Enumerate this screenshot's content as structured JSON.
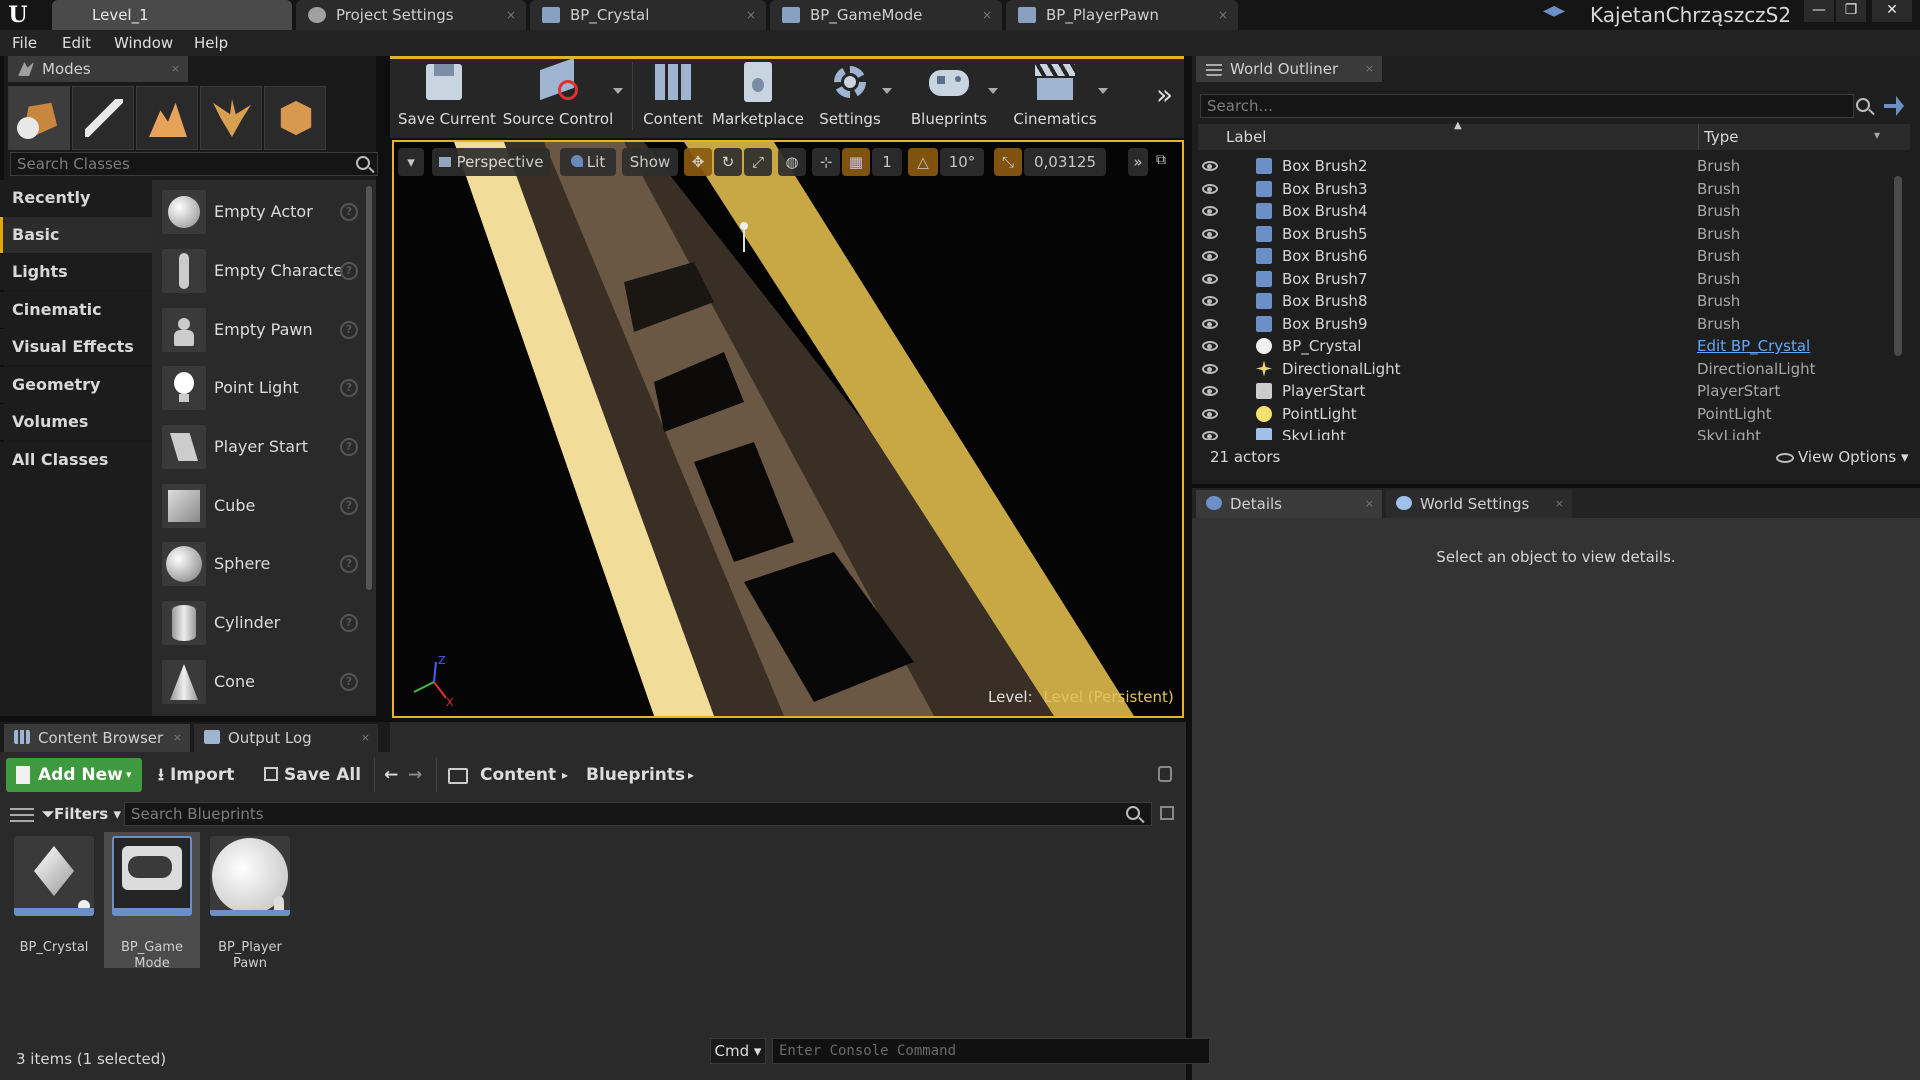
{
  "title_bar": {
    "logo": "U",
    "tabs": [
      {
        "label": "Level_1",
        "close": "×"
      },
      {
        "label": "Project Settings",
        "close": "×"
      },
      {
        "label": "BP_Crystal",
        "close": "×"
      },
      {
        "label": "BP_GameMode",
        "close": "×"
      },
      {
        "label": "BP_PlayerPawn",
        "close": "×"
      }
    ],
    "user": "KajetanChrząszczS2",
    "window_controls": {
      "minimize": "—",
      "restore": "❐",
      "close": "✕"
    }
  },
  "menu": {
    "items": [
      "File",
      "Edit",
      "Window",
      "Help"
    ]
  },
  "modes_panel": {
    "tab_label": "Modes",
    "tab_close": "×",
    "search_placeholder": "Search Classes",
    "categories": [
      "Recently Placed",
      "Basic",
      "Lights",
      "Cinematic",
      "Visual Effects",
      "Geometry",
      "Volumes",
      "All Classes"
    ],
    "active_category": "Basic",
    "items": [
      "Empty Actor",
      "Empty Characte",
      "Empty Pawn",
      "Point Light",
      "Player Start",
      "Cube",
      "Sphere",
      "Cylinder",
      "Cone"
    ],
    "help_glyph": "?"
  },
  "toolbar": {
    "buttons": [
      {
        "label": "Save Current",
        "icon": "save-icon"
      },
      {
        "label": "Source Control",
        "icon": "source-control-icon"
      },
      {
        "label": "Content",
        "icon": "content-icon"
      },
      {
        "label": "Marketplace",
        "icon": "marketplace-icon"
      },
      {
        "label": "Settings",
        "icon": "settings-icon"
      },
      {
        "label": "Blueprints",
        "icon": "blueprints-icon"
      },
      {
        "label": "Cinematics",
        "icon": "cinematics-icon"
      }
    ],
    "overflow": "»"
  },
  "viewport": {
    "menu_glyph": "▾",
    "view_mode": "Perspective",
    "lighting": "Lit",
    "show": "Show",
    "grid_snap": "1",
    "rotation_snap": "10°",
    "scale_snap": "0,03125",
    "more": "»",
    "maximize": "⧉",
    "level_prefix": "Level:",
    "level_name": "Level (Persistent)",
    "axis_z": "Z",
    "axis_x": "X",
    "accent_color": "#e6b422"
  },
  "world_outliner": {
    "tab_label": "World Outliner",
    "tab_close": "×",
    "search_placeholder": "Search...",
    "columns": {
      "label": "Label",
      "type": "Type"
    },
    "sort_glyph": "▲",
    "type_menu": "▾",
    "rows": [
      {
        "label": "Box Brush2",
        "type": "Brush"
      },
      {
        "label": "Box Brush3",
        "type": "Brush"
      },
      {
        "label": "Box Brush4",
        "type": "Brush"
      },
      {
        "label": "Box Brush5",
        "type": "Brush"
      },
      {
        "label": "Box Brush6",
        "type": "Brush"
      },
      {
        "label": "Box Brush7",
        "type": "Brush"
      },
      {
        "label": "Box Brush8",
        "type": "Brush"
      },
      {
        "label": "Box Brush9",
        "type": "Brush"
      },
      {
        "label": "BP_Crystal",
        "type": "Edit BP_Crystal"
      },
      {
        "label": "DirectionalLight",
        "type": "DirectionalLight"
      },
      {
        "label": "PlayerStart",
        "type": "PlayerStart"
      },
      {
        "label": "PointLight",
        "type": "PointLight"
      },
      {
        "label": "SkyLight",
        "type": "SkyLight"
      }
    ],
    "actor_count": "21 actors",
    "view_options": "View Options"
  },
  "details_panel": {
    "tabs": [
      "Details",
      "World Settings"
    ],
    "tab_close": "×",
    "empty_message": "Select an object to view details."
  },
  "content_browser": {
    "tabs": [
      "Content Browser",
      "Output Log"
    ],
    "tab_close": "×",
    "add_new": "Add New",
    "import": "Import",
    "save_all": "Save All",
    "nav_back": "←",
    "nav_forward": "→",
    "breadcrumb": [
      "Content",
      "Blueprints"
    ],
    "breadcrumb_sep": "▸",
    "filters": "Filters",
    "search_placeholder": "Search Blueprints",
    "assets": [
      {
        "line1": "BP_Crystal",
        "line2": ""
      },
      {
        "line1": "BP_Game",
        "line2": "Mode"
      },
      {
        "line1": "BP_Player",
        "line2": "Pawn"
      }
    ],
    "selected_asset": "BP_Game Mode",
    "status": "3 items (1 selected)"
  },
  "console": {
    "cmd_label": "Cmd",
    "placeholder": "Enter Console Command"
  }
}
